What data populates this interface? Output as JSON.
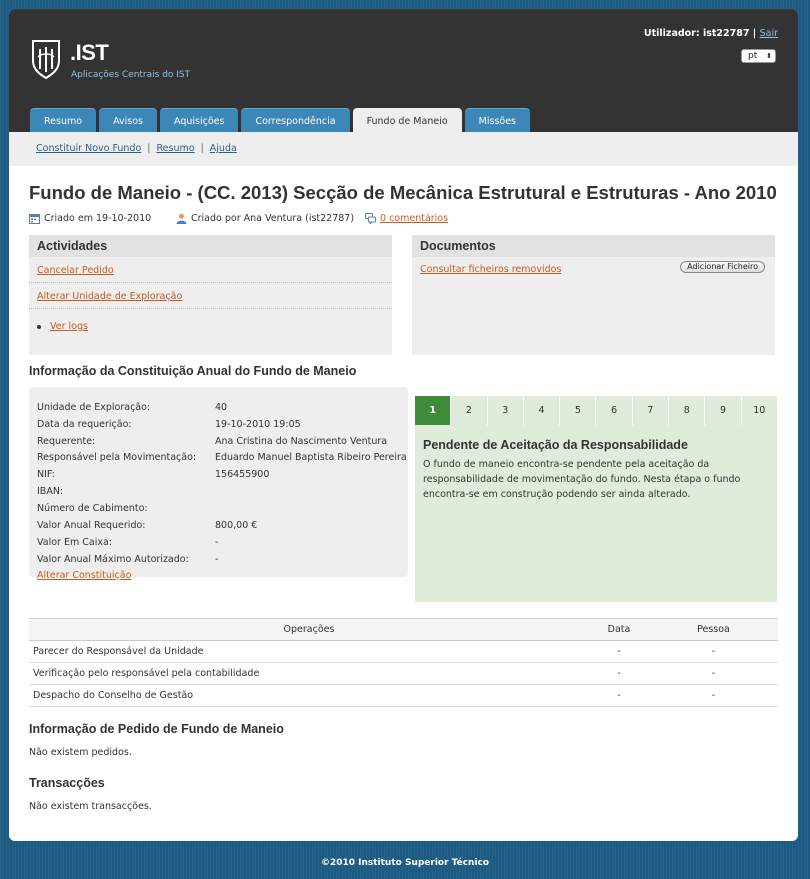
{
  "header": {
    "app_name": ".IST",
    "app_subtitle": "Aplicações Centrais do IST",
    "user_label": "Utilizador: ist22787",
    "separator": "|",
    "logout_label": "Sair",
    "language": "pt"
  },
  "tabs": [
    {
      "label": "Resumo"
    },
    {
      "label": "Avisos"
    },
    {
      "label": "Aquisições"
    },
    {
      "label": "Correspondência"
    },
    {
      "label": "Fundo de Maneio",
      "active": true
    },
    {
      "label": "Missões"
    }
  ],
  "subnav": {
    "items": [
      "Constituir Novo Fundo",
      "Resumo",
      "Ajuda"
    ],
    "separator": "|"
  },
  "page": {
    "title": "Fundo de Maneio - (CC. 2013) Secção de Mecânica Estrutural e Estruturas - Ano 2010",
    "created_on": "Criado em 19-10-2010",
    "created_by": "Criado por Ana Ventura (ist22787)",
    "comments": "0 comentários"
  },
  "activities": {
    "title": "Actividades",
    "links": [
      "Cancelar Pedido",
      "Alterar Unidade de Exploração"
    ],
    "bullet_link": "Ver logs"
  },
  "documents": {
    "title": "Documentos",
    "link": "Consultar ficheiros removidos",
    "add_button": "Adicionar Ficheiro"
  },
  "info": {
    "title": "Informação da Constituição Anual do Fundo de Maneio",
    "rows": [
      {
        "label": "Unidade de Exploração:",
        "value": "40"
      },
      {
        "label": "Data da requerição:",
        "value": "19-10-2010 19:05"
      },
      {
        "label": "Requerente:",
        "value": "Ana Cristina do Nascimento Ventura"
      },
      {
        "label": "Responsável pela Movimentação:",
        "value": "Eduardo Manuel Baptista Ribeiro Pereira"
      },
      {
        "label": "NIF:",
        "value": "156455900"
      },
      {
        "label": "IBAN:",
        "value": ""
      },
      {
        "label": "Número de Cabimento:",
        "value": ""
      },
      {
        "label": "Valor Anual Requerido:",
        "value": "800,00 €"
      },
      {
        "label": "Valor Em Caixa:",
        "value": "-"
      },
      {
        "label": "Valor Anual Máximo Autorizado:",
        "value": "-"
      }
    ],
    "alter_link": "Alterar Constituição"
  },
  "workflow": {
    "steps": [
      "1",
      "2",
      "3",
      "4",
      "5",
      "6",
      "7",
      "8",
      "9",
      "10"
    ],
    "active_step": "1",
    "state_title": "Pendente de Aceitação da Responsabilidade",
    "state_description": "O fundo de maneio encontra-se pendente pela aceitação da responsabilidade de movimentação do fundo. Nesta étapa o fundo encontra-se em construção podendo ser ainda alterado."
  },
  "operations": {
    "headers": [
      "Operações",
      "Data",
      "Pessoa"
    ],
    "rows": [
      [
        "Parecer do Responsável da Unidade",
        "-",
        "-"
      ],
      [
        "Verificação pelo responsável pela contabilidade",
        "-",
        "-"
      ],
      [
        "Despacho do Conselho de Gestão",
        "-",
        "-"
      ]
    ]
  },
  "requests": {
    "title": "Informação de Pedido de Fundo de Maneio",
    "empty": "Não existem pedidos."
  },
  "transactions": {
    "title": "Transacções",
    "empty": "Não existem transacções."
  },
  "footer": {
    "text": "©2010 Instituto Superior Técnico"
  },
  "colors": {
    "header_bg": "#333333",
    "tab_blue": "#3c86b8",
    "link_orange": "#c85a20",
    "step_active": "#3f8a3b",
    "step_bg": "#dfecd9",
    "page_bg": "#1e5b82"
  }
}
